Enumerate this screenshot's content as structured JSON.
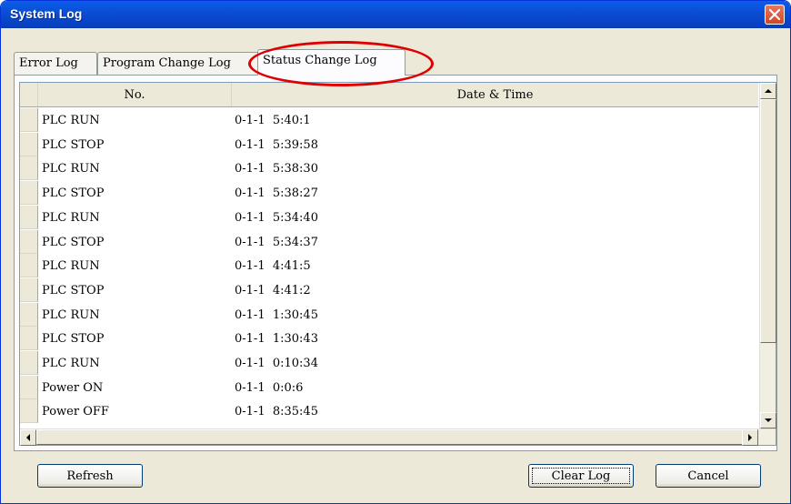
{
  "window": {
    "title": "System Log"
  },
  "tabs": [
    {
      "label": "Error Log"
    },
    {
      "label": "Program Change Log"
    },
    {
      "label": "Status Change Log"
    }
  ],
  "table": {
    "columns": [
      "No.",
      "Date & Time"
    ],
    "rows": [
      {
        "status": "PLC RUN",
        "datetime": "0-1-1  5:40:1"
      },
      {
        "status": "PLC STOP",
        "datetime": "0-1-1  5:39:58"
      },
      {
        "status": "PLC RUN",
        "datetime": "0-1-1  5:38:30"
      },
      {
        "status": "PLC STOP",
        "datetime": "0-1-1  5:38:27"
      },
      {
        "status": "PLC RUN",
        "datetime": "0-1-1  5:34:40"
      },
      {
        "status": "PLC STOP",
        "datetime": "0-1-1  5:34:37"
      },
      {
        "status": "PLC RUN",
        "datetime": "0-1-1  4:41:5"
      },
      {
        "status": "PLC STOP",
        "datetime": "0-1-1  4:41:2"
      },
      {
        "status": "PLC RUN",
        "datetime": "0-1-1  1:30:45"
      },
      {
        "status": "PLC STOP",
        "datetime": "0-1-1  1:30:43"
      },
      {
        "status": "PLC RUN",
        "datetime": "0-1-1  0:10:34"
      },
      {
        "status": "Power ON",
        "datetime": "0-1-1  0:0:6"
      },
      {
        "status": "Power OFF",
        "datetime": "0-1-1  8:35:45"
      }
    ]
  },
  "buttons": {
    "refresh": "Refresh",
    "clear_log": "Clear Log",
    "cancel": "Cancel"
  },
  "colors": {
    "title_bar": "#0b4ed6",
    "close_button": "#d2442a",
    "annotation_ellipse": "#e00000"
  }
}
